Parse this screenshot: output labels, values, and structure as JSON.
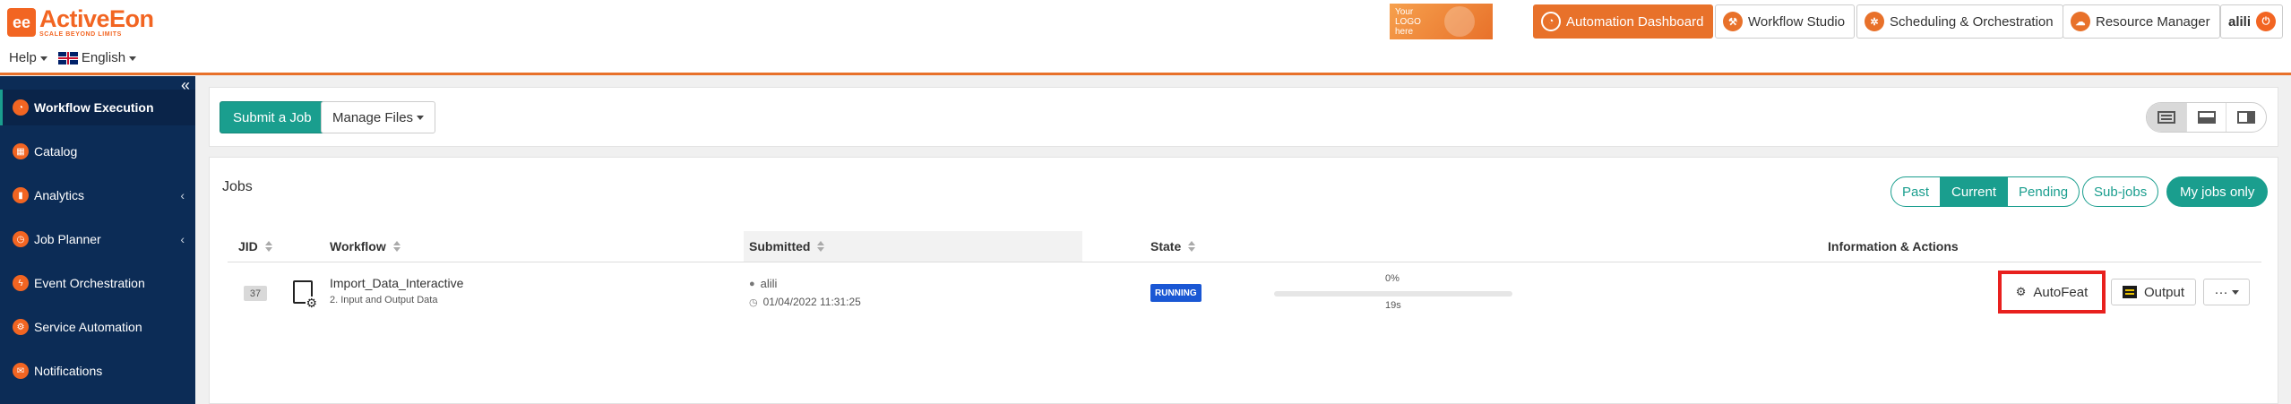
{
  "header": {
    "brand_name": "ActiveEon",
    "brand_tagline": "SCALE BEYOND LIMITS",
    "help_label": "Help",
    "language_label": "English",
    "custom_logo_text": "Your LOGO here",
    "nav": [
      {
        "label": "Automation Dashboard",
        "active": true
      },
      {
        "label": "Workflow Studio",
        "active": false
      },
      {
        "label": "Scheduling & Orchestration",
        "active": false
      },
      {
        "label": "Resource Manager",
        "active": false
      }
    ],
    "user": "alili"
  },
  "sidebar": {
    "collapse_glyph": "«",
    "items": [
      {
        "label": "Workflow Execution",
        "active": true
      },
      {
        "label": "Catalog",
        "active": false
      },
      {
        "label": "Analytics",
        "active": false,
        "has_children": true
      },
      {
        "label": "Job Planner",
        "active": false,
        "has_children": true
      },
      {
        "label": "Event Orchestration",
        "active": false
      },
      {
        "label": "Service Automation",
        "active": false
      },
      {
        "label": "Notifications",
        "active": false
      }
    ]
  },
  "toolbar": {
    "submit_label": "Submit a Job",
    "manage_files_label": "Manage Files"
  },
  "jobs": {
    "title": "Jobs",
    "filters": [
      "Past",
      "Current",
      "Pending"
    ],
    "active_filter": "Current",
    "sub_jobs_label": "Sub-jobs",
    "my_jobs_label": "My jobs only",
    "columns": {
      "jid": "JID",
      "workflow": "Workflow",
      "submitted": "Submitted",
      "state": "State",
      "info": "Information & Actions"
    },
    "rows": [
      {
        "jid": "37",
        "workflow_name": "Import_Data_Interactive",
        "workflow_sub": "2. Input and Output Data",
        "owner": "alili",
        "submitted_at": "01/04/2022 11:31:25",
        "state": "RUNNING",
        "progress_label": "0%",
        "progress": 0,
        "duration": "19s",
        "actions": {
          "autofeat": "AutoFeat",
          "output": "Output",
          "more": "···"
        }
      }
    ]
  },
  "colors": {
    "accent": "#e8712a",
    "sidebar": "#0c2c56",
    "teal": "#1a9e8e",
    "running": "#1a57d4",
    "highlight": "#e8201e"
  }
}
